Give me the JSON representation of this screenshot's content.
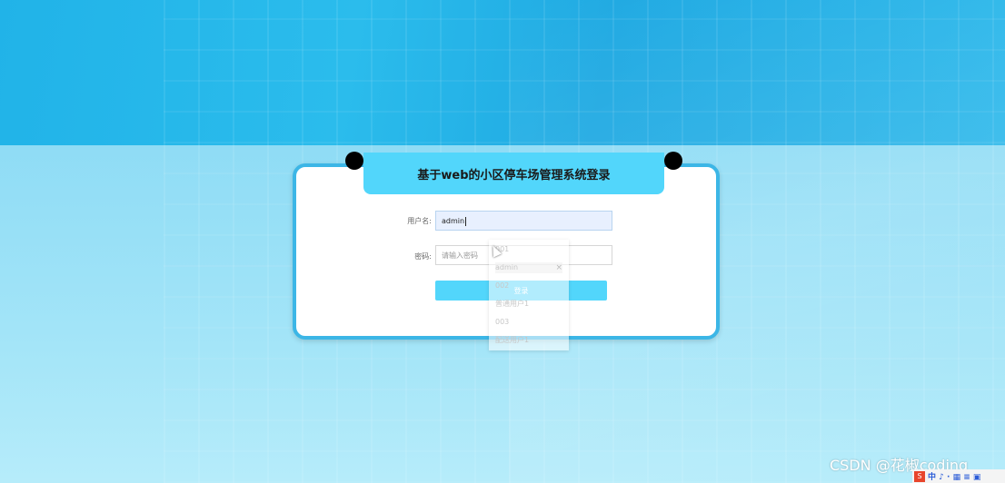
{
  "login": {
    "title": "基于web的小区停车场管理系统登录",
    "username_label": "用户名:",
    "username_value": "admin",
    "password_label": "密码:",
    "password_placeholder": "请输入密码",
    "login_button": "登录"
  },
  "autocomplete": {
    "items": [
      "001",
      "admin",
      "002",
      "普通用户1",
      "003",
      "配送用户1"
    ],
    "close_symbol": "×"
  },
  "watermark": "CSDN @花椒coding",
  "tray": {
    "s": "S",
    "text": "中 ♪ · ▦ ≡ ▣"
  }
}
